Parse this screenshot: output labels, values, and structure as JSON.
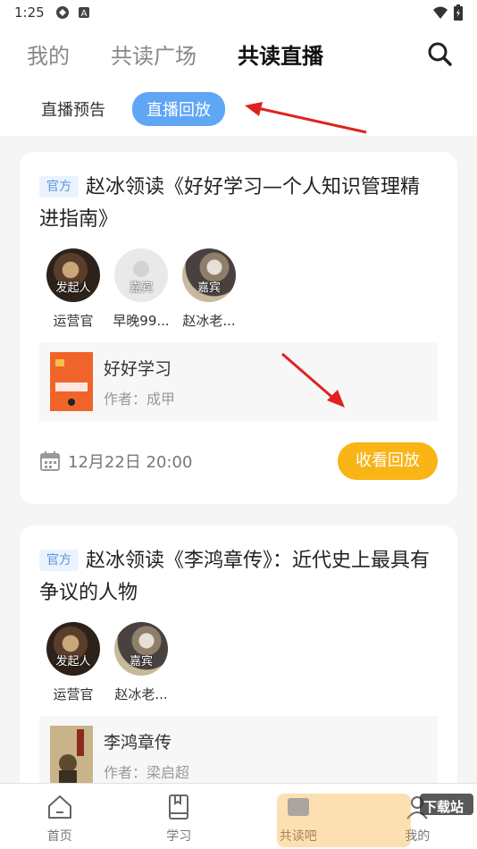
{
  "status": {
    "time": "1:25"
  },
  "topnav": {
    "tabs": [
      "我的",
      "共读广场",
      "共读直播"
    ]
  },
  "subtabs": [
    "直播预告",
    "直播回放"
  ],
  "cards": [
    {
      "badge": "官方",
      "title": "赵冰领读《好好学习—个人知识管理精进指南》",
      "participants": [
        {
          "role": "发起人",
          "name": "运营官"
        },
        {
          "role": "嘉宾",
          "name": "早晚99..."
        },
        {
          "role": "嘉宾",
          "name": "赵冰老..."
        }
      ],
      "book": {
        "title": "好好学习",
        "author": "作者：成甲"
      },
      "datetime": "12月22日 20:00",
      "button": "收看回放"
    },
    {
      "badge": "官方",
      "title": "赵冰领读《李鸿章传》：近代史上最具有争议的人物",
      "participants": [
        {
          "role": "发起人",
          "name": "运营官"
        },
        {
          "role": "嘉宾",
          "name": "赵冰老..."
        }
      ],
      "book": {
        "title": "李鸿章传",
        "author": "作者：梁启超"
      }
    }
  ],
  "bottomnav": [
    "首页",
    "学习",
    "共读吧",
    "我的"
  ],
  "watermark": "下载站",
  "icons": {
    "search": "search-icon",
    "calendar": "calendar-icon",
    "home": "home-icon",
    "study": "book-icon"
  },
  "colors": {
    "accent": "#5fa6f5",
    "button": "#f9b416",
    "arrow": "#e0221e"
  }
}
